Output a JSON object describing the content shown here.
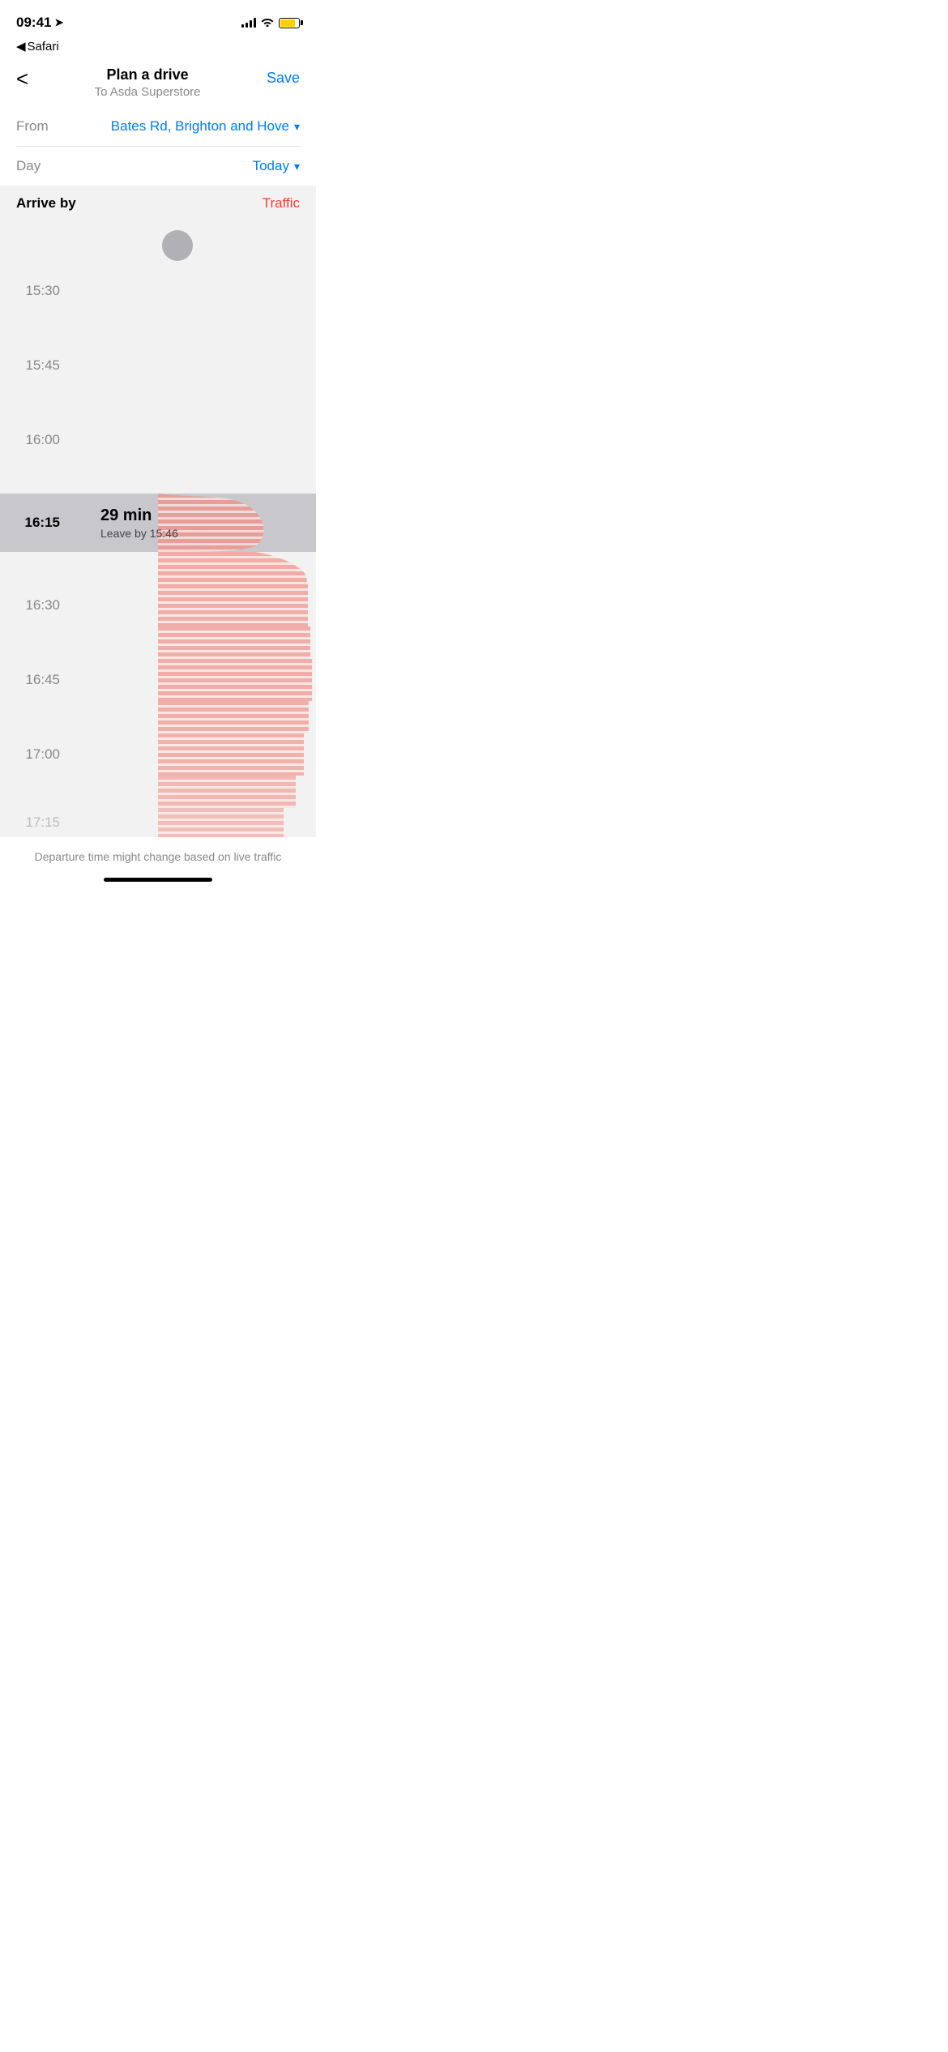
{
  "statusBar": {
    "time": "09:41",
    "locationIcon": "▶",
    "batteryColor": "#FFD000"
  },
  "safariBack": "◀ Safari",
  "nav": {
    "backLabel": "<",
    "title": "Plan a drive",
    "subtitle": "To Asda Superstore",
    "saveLabel": "Save"
  },
  "fromField": {
    "label": "From",
    "value": "Bates Rd, Brighton and Hove",
    "chevron": "▾"
  },
  "dayField": {
    "label": "Day",
    "value": "Today",
    "chevron": "▾"
  },
  "chart": {
    "arriveByLabel": "Arrive by",
    "trafficLabel": "Traffic",
    "times": [
      {
        "time": "",
        "selected": false,
        "showDot": true
      },
      {
        "time": "15:30",
        "selected": false
      },
      {
        "time": "",
        "selected": false
      },
      {
        "time": "15:45",
        "selected": false
      },
      {
        "time": "",
        "selected": false
      },
      {
        "time": "16:00",
        "selected": false
      },
      {
        "time": "",
        "selected": false
      },
      {
        "time": "16:15",
        "selected": true,
        "mainText": "29 min",
        "subText": "Leave by 15:46"
      },
      {
        "time": "",
        "selected": false,
        "traffic": true
      },
      {
        "time": "16:30",
        "selected": false,
        "traffic": true
      },
      {
        "time": "",
        "selected": false,
        "traffic": true
      },
      {
        "time": "16:45",
        "selected": false,
        "traffic": true
      },
      {
        "time": "",
        "selected": false,
        "traffic": true
      },
      {
        "time": "17:00",
        "selected": false,
        "traffic": true
      },
      {
        "time": "",
        "selected": false,
        "traffic": true
      },
      {
        "time": "17:15",
        "selected": false,
        "traffic": true
      }
    ]
  },
  "footer": {
    "note": "Departure time might change based on live traffic"
  },
  "icons": {
    "location": "➤",
    "back": "<",
    "chevronDown": "▾"
  }
}
